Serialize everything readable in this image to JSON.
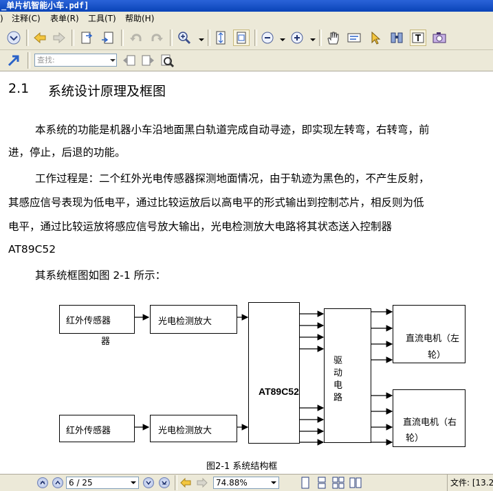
{
  "window": {
    "title": "_单片机智能小车.pdf]"
  },
  "menu": {
    "items": [
      {
        "label": ")"
      },
      {
        "label": "注释(C)"
      },
      {
        "label": "表单(R)"
      },
      {
        "label": "工具(T)"
      },
      {
        "label": "帮助(H)"
      }
    ]
  },
  "toolbar": {
    "icons": [
      "down-circle-icon",
      "back-arrow-icon",
      "forward-arrow-icon",
      "page-extract-icon",
      "page-insert-icon",
      "undo-icon",
      "redo-icon",
      "zoom-in-icon",
      "fit-page-icon",
      "actual-size-icon",
      "zoom-out-icon",
      "zoom-plus-icon",
      "hand-tool-icon",
      "select-text-icon",
      "pointer-icon",
      "find-binoculars-icon",
      "text-select-icon",
      "snapshot-camera-icon"
    ],
    "search_placeholder": "查找:"
  },
  "document": {
    "heading_number": "2.1",
    "heading_text": "系统设计原理及框图",
    "paragraphs": [
      "本系统的功能是机器小车沿地面黑白轨道完成自动寻迹，即实现左转弯，右转弯，前",
      "进，停止，后退的功能。",
      "工作过程是：二个红外光电传感器探测地面情况，由于轨迹为黑色的，不产生反射，",
      "其感应信号表现为低电平，通过比较运放后以高电平的形式输出到控制芯片，相反则为低",
      "电平，通过比较运放将感应信号放大输出，光电检测放大电路将其状态送入控制器",
      "AT89C52",
      "其系统框图如图  2-1 所示："
    ],
    "diagram": {
      "sensor_top_line1": "红外传感器",
      "sensor_top_line2": "器",
      "amp_top": "光电检测放大",
      "controller": "AT89C52",
      "driver": [
        "驱",
        "动",
        "电",
        "路"
      ],
      "motor_left_line1": "直流电机（左",
      "motor_left_line2": "轮）",
      "sensor_bottom": "红外传感器",
      "amp_bottom": "光电检测放大",
      "motor_right_line1": "直流电机（右",
      "motor_right_line2": "轮）",
      "caption": "图2-1   系统结构框"
    }
  },
  "statusbar": {
    "page_value": "6 / 25",
    "zoom_value": "74.88%",
    "file_info": "文件: [13.2"
  }
}
